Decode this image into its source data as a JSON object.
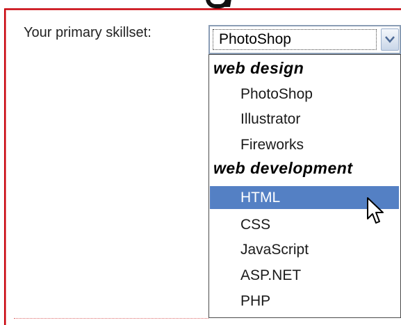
{
  "form": {
    "label": "Your primary skillset:",
    "select": {
      "selected_value": "PhotoShop"
    }
  },
  "dropdown": {
    "groups": [
      {
        "label": "web design",
        "options": [
          "PhotoShop",
          "Illustrator",
          "Fireworks"
        ]
      },
      {
        "label": "web development",
        "options": [
          "HTML",
          "CSS",
          "JavaScript",
          "ASP.NET",
          "PHP"
        ]
      }
    ],
    "highlighted_option": "HTML"
  },
  "icons": {
    "select_arrow": "chevron-down-icon",
    "mouse_cursor": "pointer-cursor-icon"
  },
  "colors": {
    "frame_border": "#c8000a",
    "highlight": "#5480c4",
    "select_border": "#8a9db5"
  }
}
